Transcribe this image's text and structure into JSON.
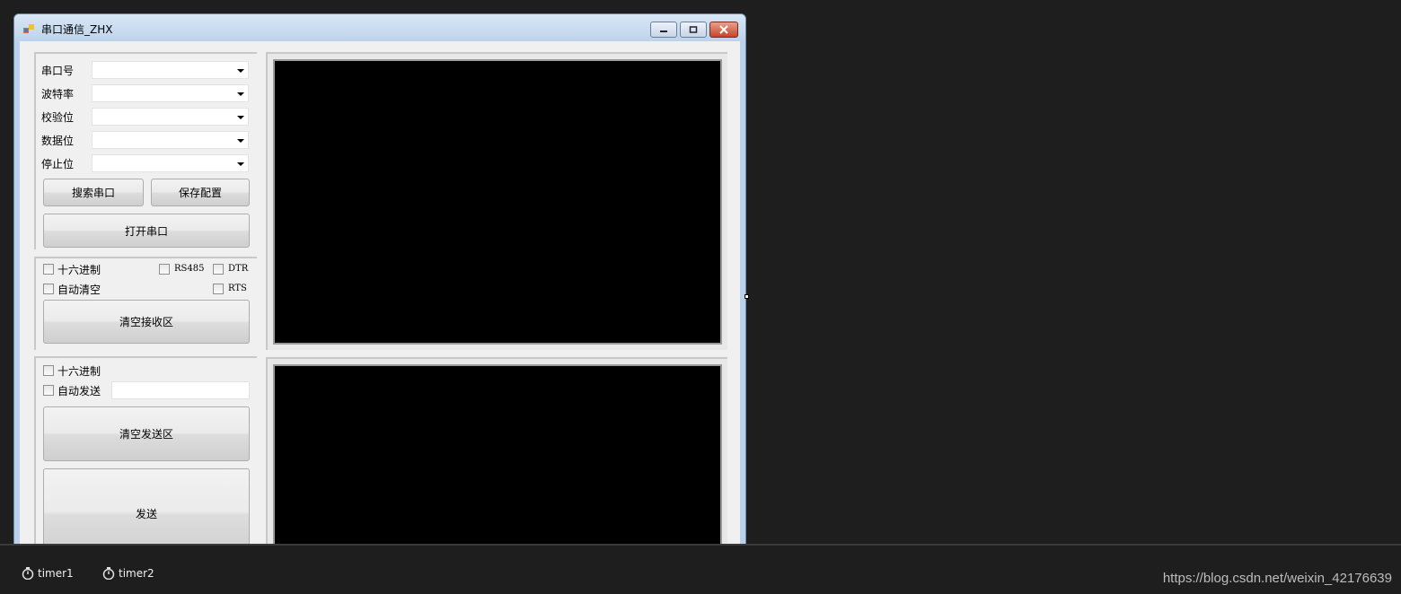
{
  "window": {
    "title": "串口通信_ZHX"
  },
  "serial_group": {
    "fields": [
      {
        "label": "串口号",
        "value": ""
      },
      {
        "label": "波特率",
        "value": ""
      },
      {
        "label": "校验位",
        "value": ""
      },
      {
        "label": "数据位",
        "value": ""
      },
      {
        "label": "停止位",
        "value": ""
      }
    ],
    "search_label": "搜索串口",
    "save_label": "保存配置",
    "open_label": "打开串口"
  },
  "receive_group": {
    "hex_label": "十六进制",
    "rs485_label": "RS485",
    "dtr_label": "DTR",
    "auto_clear_label": "自动清空",
    "rts_label": "RTS",
    "clear_label": "清空接收区"
  },
  "send_group": {
    "hex_label": "十六进制",
    "auto_send_label": "自动发送",
    "interval_value": "",
    "clear_label": "清空发送区",
    "send_label": "发送"
  },
  "tray": {
    "items": [
      "timer1",
      "timer2"
    ]
  },
  "watermark": "https://blog.csdn.net/weixin_42176639"
}
